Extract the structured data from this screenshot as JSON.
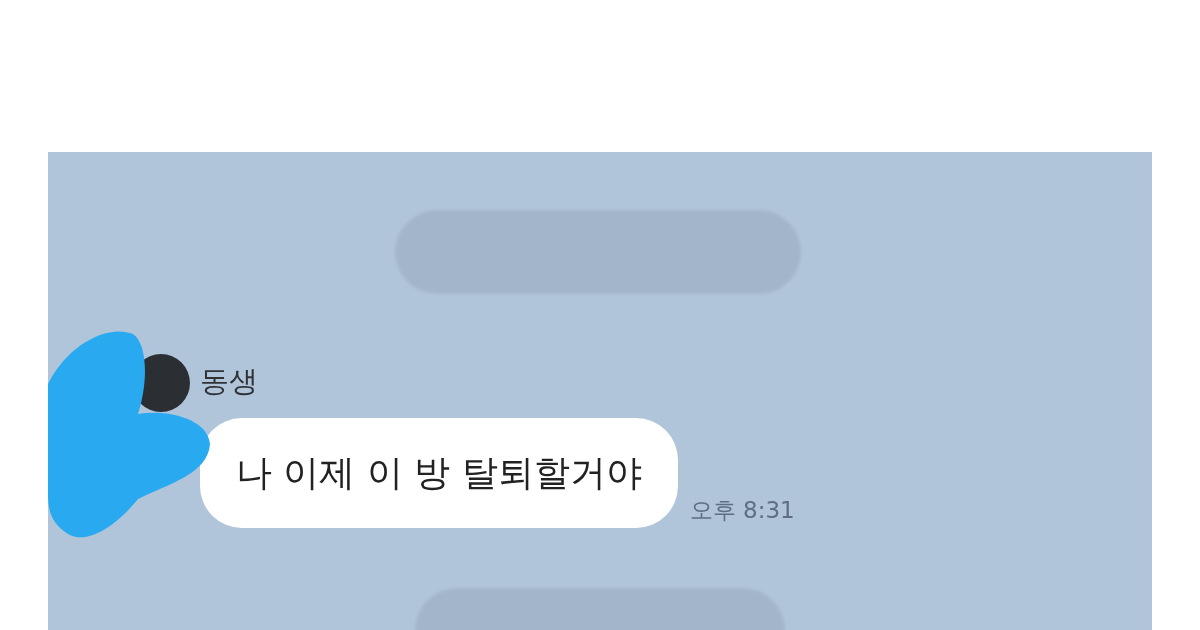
{
  "messages": [
    {
      "sender": "동생",
      "text": "나 이제 이 방 탈퇴할거야",
      "time": "오후 8:31"
    }
  ]
}
